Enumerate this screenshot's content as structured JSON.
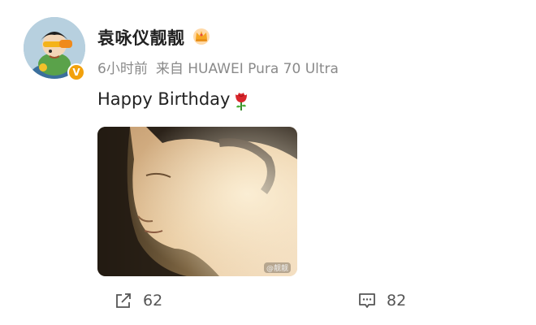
{
  "post": {
    "author": {
      "name": "袁咏仪靓靓",
      "avatar_icon": "cartoon-avatar",
      "verified_badge": "V",
      "verified_color": "#f2a10c",
      "member_icon": "crown-icon"
    },
    "time": "6小时前",
    "source_prefix": "来自",
    "source_device": "HUAWEI Pura 70 Ultra",
    "text": "Happy Birthday",
    "emoji_icon": "rose-icon",
    "image": {
      "description_icon": "portrait-photo",
      "watermark": "@靓靓"
    }
  },
  "actions": {
    "share": {
      "icon": "share-icon",
      "count": "62"
    },
    "comment": {
      "icon": "comment-icon",
      "count": "82"
    }
  }
}
